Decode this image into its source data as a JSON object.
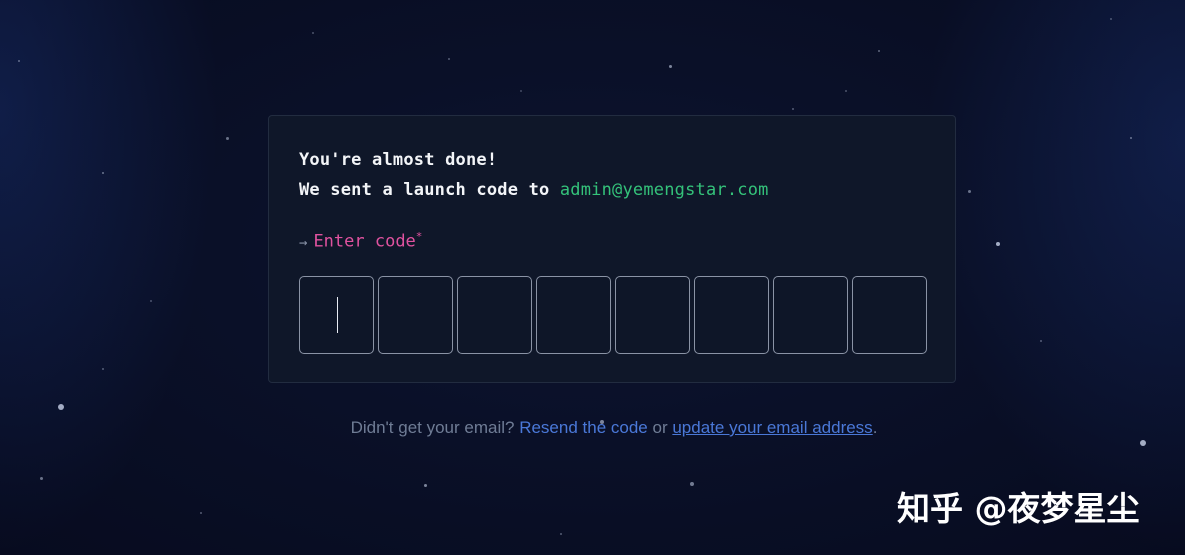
{
  "card": {
    "line1": "You're almost done!",
    "line2_prefix": "We sent a launch code to ",
    "email": "admin@yemengstar.com",
    "prompt_arrow": "→",
    "prompt_label": "Enter code",
    "prompt_required": "*",
    "code_digits": [
      "",
      "",
      "",
      "",
      "",
      "",
      "",
      ""
    ]
  },
  "footer": {
    "question": "Didn't get your email?",
    "resend": "Resend the code",
    "or": "or",
    "update": "update your email address",
    "period": "."
  },
  "watermark": "知乎 @夜梦星尘",
  "colors": {
    "background": "#0a1028",
    "card": "#0f1729",
    "email": "#34c27a",
    "prompt": "#e0529f",
    "link": "#4a78d8"
  }
}
